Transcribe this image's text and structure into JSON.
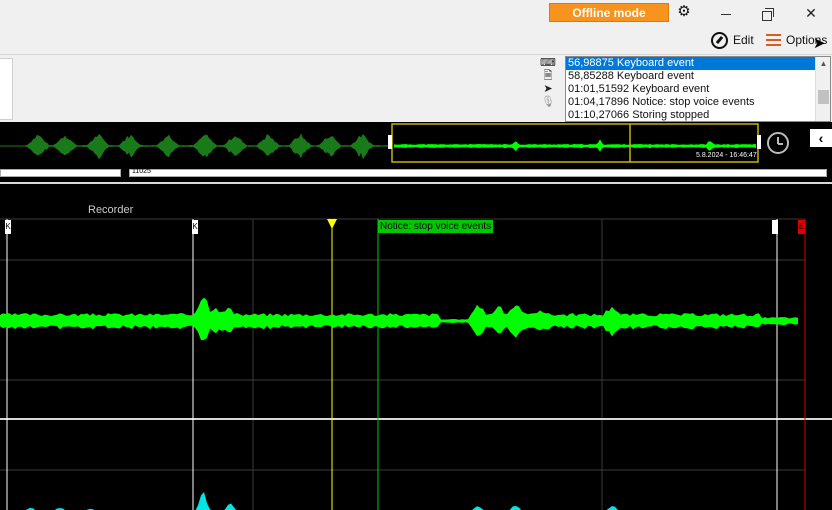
{
  "titlebar": {
    "offline_badge": "Offline mode",
    "settings_icon": "gear-icon",
    "window_buttons": [
      "minimize-icon",
      "maximize-icon",
      "close-icon"
    ]
  },
  "menu": {
    "edit_label": "Edit",
    "options_label": "Options"
  },
  "event_log": {
    "source_icons": [
      "keyboard-icon",
      "document-icon",
      "cursor-icon",
      "microphone-icon"
    ],
    "items": [
      {
        "text": "56,98875 Keyboard event",
        "selected": true
      },
      {
        "text": "58,85288 Keyboard event",
        "selected": false
      },
      {
        "text": "01:01,51592 Keyboard event",
        "selected": false
      },
      {
        "text": "01:04,17896 Notice: stop voice events",
        "selected": false
      },
      {
        "text": "01:10,27066 Storing stopped",
        "selected": false
      }
    ]
  },
  "overview": {
    "timestamp": "5.8.2024 - 16:46:47",
    "waveform_color": "#1a7a1a",
    "selection_color": "#c8b400",
    "selected_wave_color": "#00ff00"
  },
  "ruler": {
    "position_label": "11025"
  },
  "track": {
    "title": "Recorder",
    "marker_label": "K",
    "notice_label": "Notice: stop voice events",
    "end_marker_label": "E",
    "wave_color_primary": "#00ff00",
    "wave_color_secondary": "#00e5e5",
    "playhead_color": "#ffff00"
  }
}
